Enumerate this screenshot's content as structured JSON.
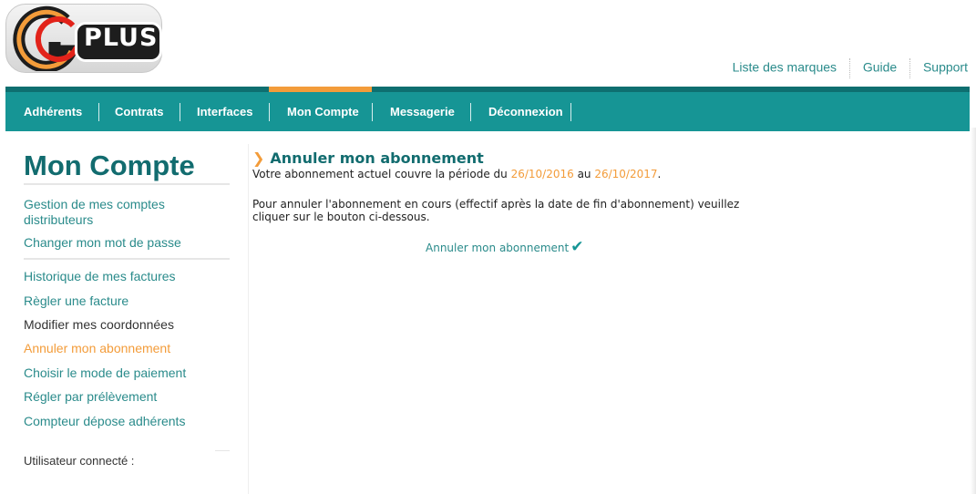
{
  "brand": {
    "logo_text": "PLUS",
    "logo_mark": "G"
  },
  "top_links": [
    "Liste des marques",
    "Guide",
    "Support"
  ],
  "nav": {
    "items": [
      "Adhérents",
      "Contrats",
      "Interfaces",
      "Mon Compte",
      "Messagerie",
      "Déconnexion"
    ],
    "active": "Mon Compte"
  },
  "sidebar": {
    "title": "Mon Compte",
    "items": [
      "Gestion de mes comptes distributeurs",
      "Changer mon mot de passe",
      "Historique de mes factures",
      "Règler une facture",
      "Modifier mes coordonnées",
      "Annuler mon abonnement",
      "Choisir le mode de paiement",
      "Régler par prélèvement",
      "Compteur dépose adhérents"
    ],
    "active_item": "Annuler mon abonnement",
    "user_label": "Utilisateur connecté :"
  },
  "main": {
    "heading": "Annuler mon abonnement",
    "line1_prefix": "Votre abonnement actuel couvre la période du ",
    "date_start": "26/10/2016",
    "line1_mid": " au ",
    "date_end": "26/10/2017",
    "line1_suffix": ".",
    "paragraph": "Pour annuler l'abonnement en cours (effectif après la date de fin d'abonnement) veuillez cliquer sur le bouton ci-dessous.",
    "cancel_button": "Annuler mon abonnement"
  },
  "colors": {
    "teal": "#169595",
    "teal_dark": "#0e6f70",
    "orange": "#f39c3a",
    "link": "#2a8b8b"
  },
  "icons": {
    "cancel_button_icon": "check-icon",
    "heading_icon": "chevron-right-icon"
  }
}
